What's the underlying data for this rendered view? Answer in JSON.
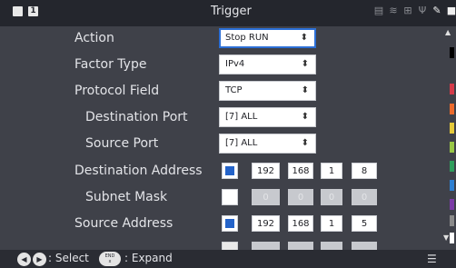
{
  "header": {
    "title": "Trigger",
    "page_badge": "1",
    "status_icons": [
      "printer-icon",
      "wifi-icon",
      "network-icon",
      "usb-icon",
      "pen-icon",
      "lock-icon",
      "battery-icon"
    ]
  },
  "form": {
    "action": {
      "label": "Action",
      "value": "Stop RUN"
    },
    "factor_type": {
      "label": "Factor Type",
      "value": "IPv4"
    },
    "protocol_field": {
      "label": "Protocol Field",
      "value": "TCP"
    },
    "destination_port": {
      "label": "Destination Port",
      "value": "[7] ALL"
    },
    "source_port": {
      "label": "Source Port",
      "value": "[7] ALL"
    },
    "destination_address": {
      "label": "Destination Address",
      "enabled": true,
      "octets": [
        "192",
        "168",
        "1",
        "8"
      ]
    },
    "subnet_mask_1": {
      "label": "Subnet Mask",
      "enabled": false,
      "octets": [
        "0",
        "0",
        "0",
        "0"
      ]
    },
    "source_address": {
      "label": "Source Address",
      "enabled": true,
      "octets": [
        "192",
        "168",
        "1",
        "5"
      ]
    }
  },
  "scrollbar": {
    "indicator_colors": [
      "#000000",
      "#d53b4a",
      "#ec6a2c",
      "#e5c93a",
      "#99c746",
      "#2f9e5c",
      "#2d7fd1",
      "#7b3aa6",
      "#8a8a8a",
      "#ffffff"
    ]
  },
  "footer": {
    "select_hint": ": Select",
    "expand_key": "END",
    "expand_key_sub": "x",
    "expand_hint": ": Expand"
  }
}
